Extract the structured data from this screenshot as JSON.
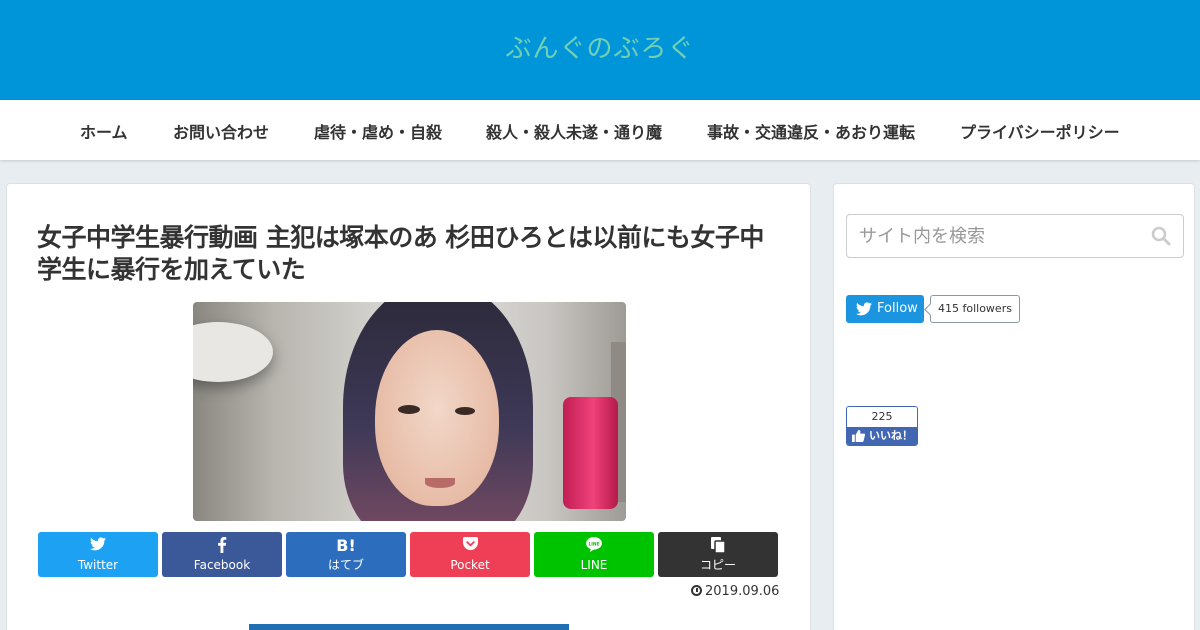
{
  "header": {
    "site_title": "ぶんぐのぶろぐ",
    "bg_color": "#0095d9",
    "title_color": "#72d0b2"
  },
  "nav": {
    "items": [
      {
        "label": "ホーム"
      },
      {
        "label": "お問い合わせ"
      },
      {
        "label": "虐待・虐め・自殺"
      },
      {
        "label": "殺人・殺人未遂・通り魔"
      },
      {
        "label": "事故・交通違反・あおり運転"
      },
      {
        "label": "プライバシーポリシー"
      }
    ]
  },
  "article": {
    "title": "女子中学生暴行動画 主犯は塚本のあ 杉田ひろとは以前にも女子中学生に暴行を加えていた",
    "date": "2019.09.06"
  },
  "share": {
    "buttons": [
      {
        "label": "Twitter",
        "icon": "twitter-icon",
        "color": "#1da1f2"
      },
      {
        "label": "Facebook",
        "icon": "facebook-icon",
        "color": "#3b5998"
      },
      {
        "label": "はてブ",
        "icon": "hatena-icon",
        "glyph": "B!",
        "color": "#2c6ebd"
      },
      {
        "label": "Pocket",
        "icon": "pocket-icon",
        "color": "#ef3f56"
      },
      {
        "label": "LINE",
        "icon": "line-icon",
        "color": "#00c300"
      },
      {
        "label": "コピー",
        "icon": "copy-icon",
        "color": "#333333"
      }
    ]
  },
  "sidebar": {
    "search_placeholder": "サイト内を検索",
    "twitter": {
      "follow_label": "Follow",
      "followers": "415 followers"
    },
    "facebook": {
      "count": "225",
      "like_label": "いいね！"
    }
  }
}
